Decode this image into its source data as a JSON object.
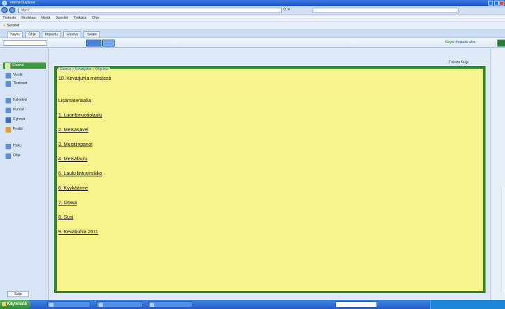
{
  "window": {
    "title": "Internet Explorer"
  },
  "address": {
    "url": "http://",
    "search_placeholder": ""
  },
  "menu": [
    "Tiedosto",
    "Muokkaa",
    "Näytä",
    "Suosikit",
    "Työkalut",
    "Ohje"
  ],
  "favorites": {
    "label": "Suosikit"
  },
  "tabs": [
    "Näytä",
    "Ohje",
    "Kirjaudu",
    "Etusivu",
    "Selain"
  ],
  "toolbar": {
    "select_value": "",
    "tab_label": "",
    "link_label": "",
    "right_label": "Näytä",
    "right_label2": "Kirjaudu ulos"
  },
  "sidebar": {
    "items": [
      {
        "label": "Etusivu",
        "color": "#57b357"
      },
      {
        "label": "Viestit",
        "color": "#5c8fd6"
      },
      {
        "label": "Tiedostot",
        "color": "#5c8fd6"
      },
      {
        "label": "Kalenteri",
        "color": "#5c8fd6"
      },
      {
        "label": "Kurssit",
        "color": "#5c8fd6"
      },
      {
        "label": "Ryhmät",
        "color": "#3f6fc6"
      },
      {
        "label": "Profiili",
        "color": "#e0a030"
      },
      {
        "label": "Haku",
        "color": "#5c8fd6"
      },
      {
        "label": "Ohje",
        "color": "#5c8fd6"
      }
    ],
    "bottom_button": "Sulje"
  },
  "content": {
    "breadcrumb": "Etusivu > Kevätjuhla > Ohjelma",
    "top_right": "Tulosta  Sulje",
    "lines": [
      {
        "text": "10.  Kevätjuhla metsässä",
        "link": false
      },
      {
        "text": "Lisämateriaalia:",
        "link": false
      },
      {
        "text": "1.  Luontonuotiolaulu",
        "link": true
      },
      {
        "text": "2.  Metsäsävel",
        "link": true
      },
      {
        "text": "3.  Muistiinpanot",
        "link": true
      },
      {
        "text": "4.  Metsälaulu",
        "link": true
      },
      {
        "text": "5.  Laulu lintuvirsikko",
        "link": true
      },
      {
        "text": "6.  Kyykäärme",
        "link": true
      },
      {
        "text": "7.  Orava",
        "link": true
      },
      {
        "text": "8.  Susi",
        "link": true
      },
      {
        "text": "9.  Kevätjuhla 2011",
        "link": true
      }
    ]
  },
  "taskbar": {
    "start_label": "Käynnistä",
    "tasks": [
      "",
      "",
      ""
    ],
    "clock": ""
  }
}
